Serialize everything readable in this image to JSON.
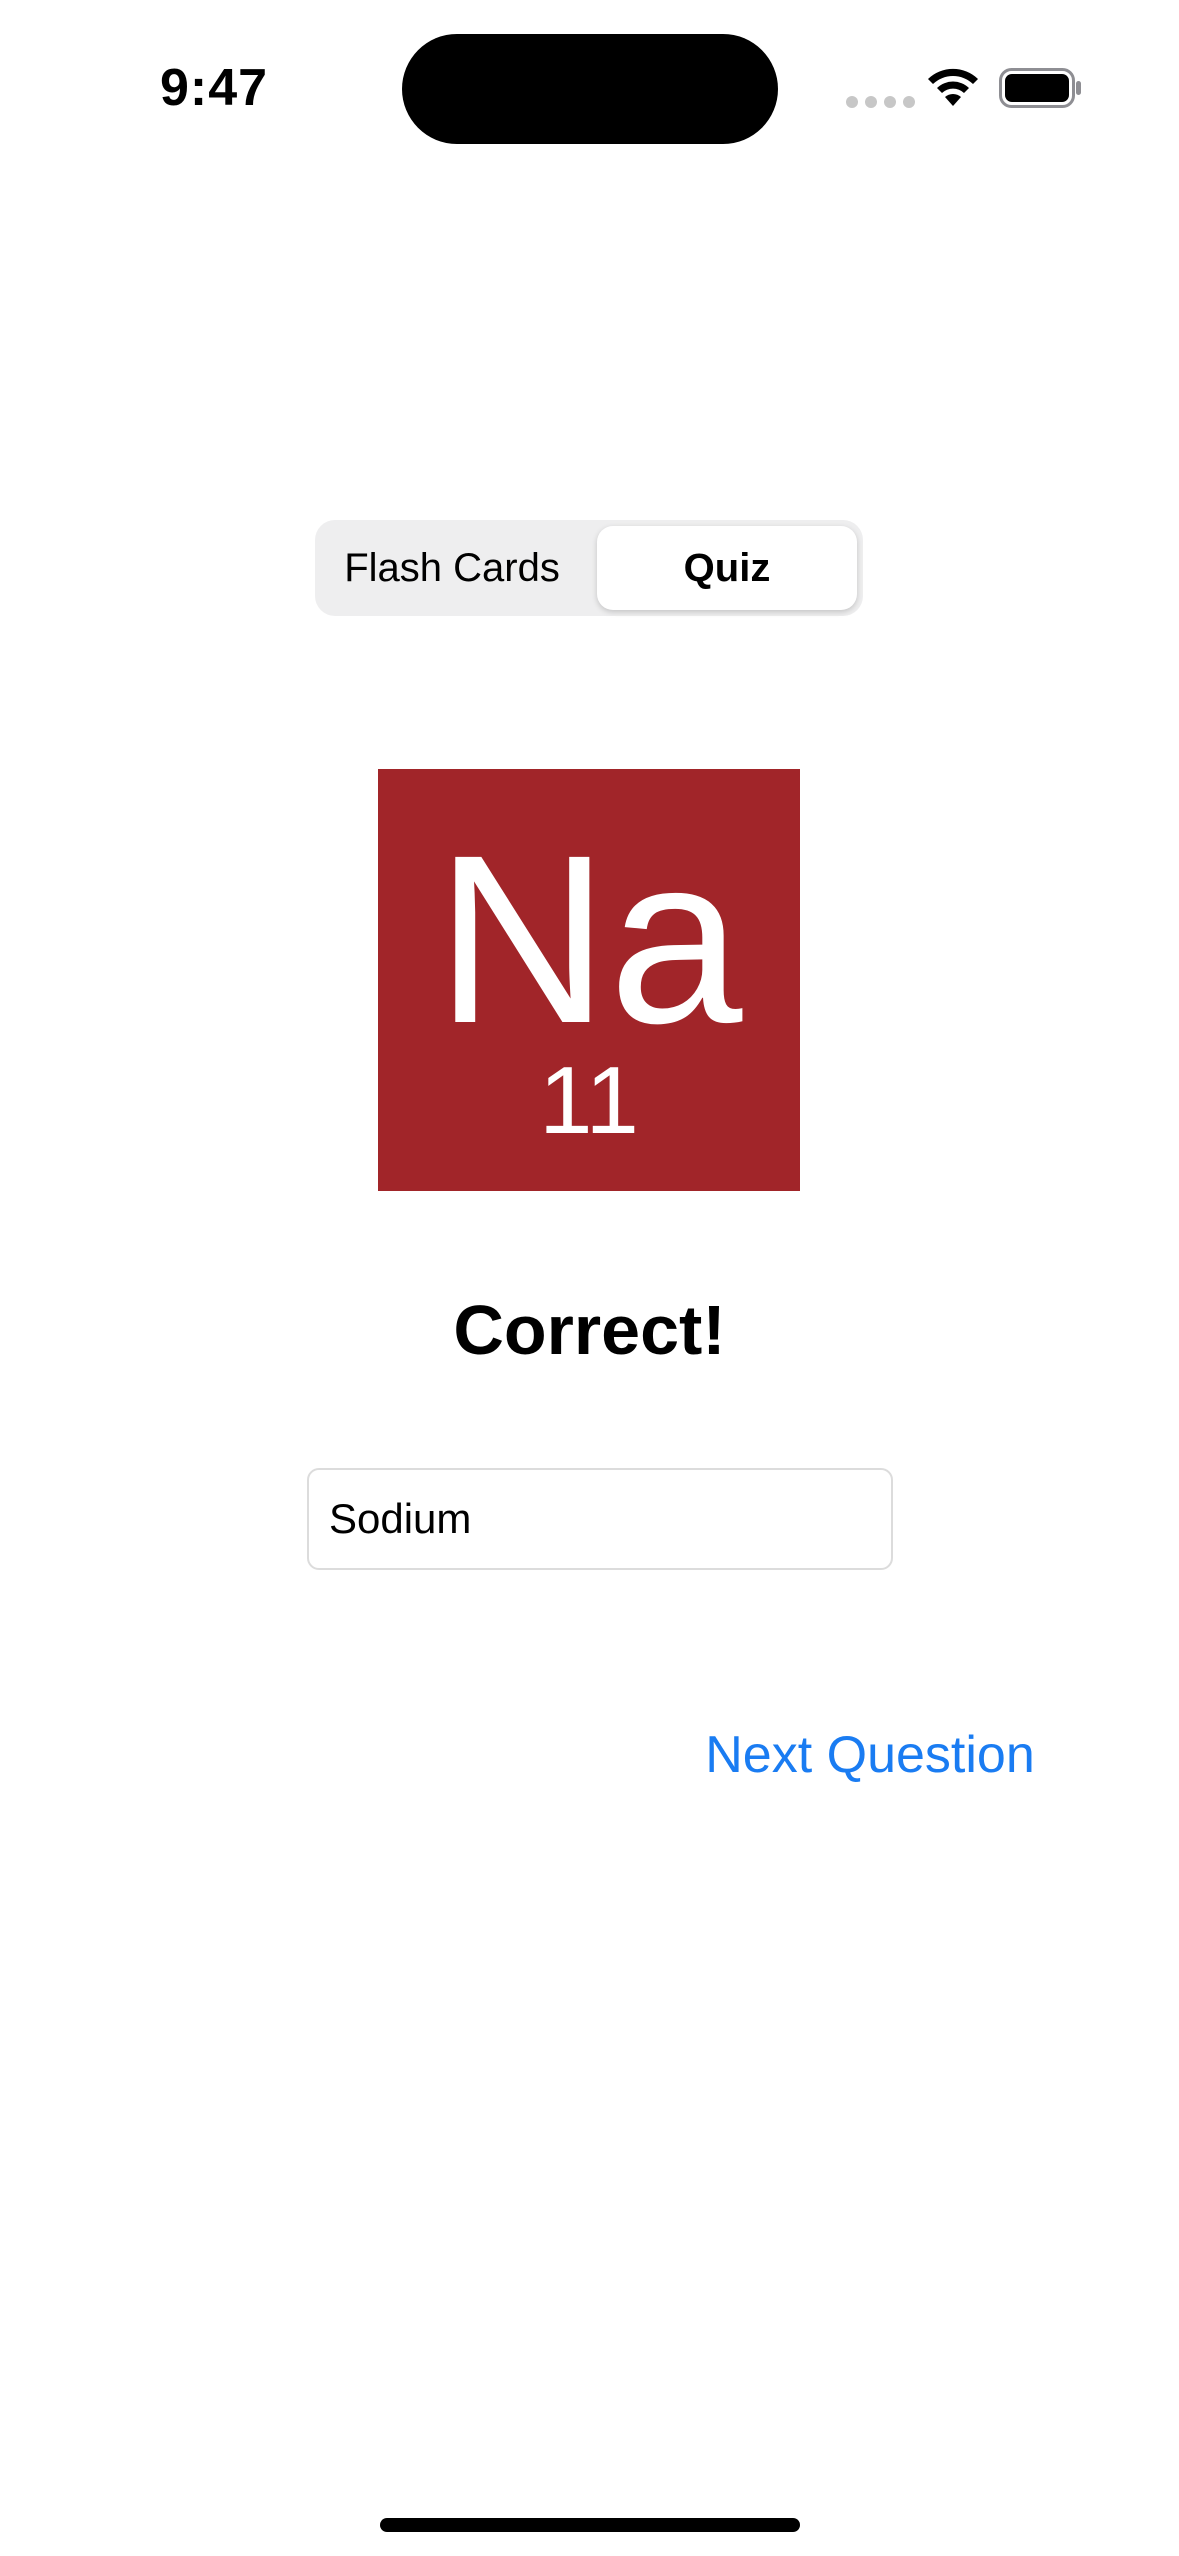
{
  "status_bar": {
    "time": "9:47",
    "wifi_icon": "wifi-icon",
    "battery_icon": "battery-full-icon"
  },
  "mode_switch": {
    "options": [
      "Flash Cards",
      "Quiz"
    ],
    "selected": "Quiz"
  },
  "element": {
    "symbol": "Na",
    "atomic_number": "11",
    "tile_color": "#a12529"
  },
  "result": {
    "text": "Correct!"
  },
  "answer": {
    "value": "Sodium"
  },
  "actions": {
    "next_label": "Next Question",
    "accent_color": "#1a7cf2"
  }
}
